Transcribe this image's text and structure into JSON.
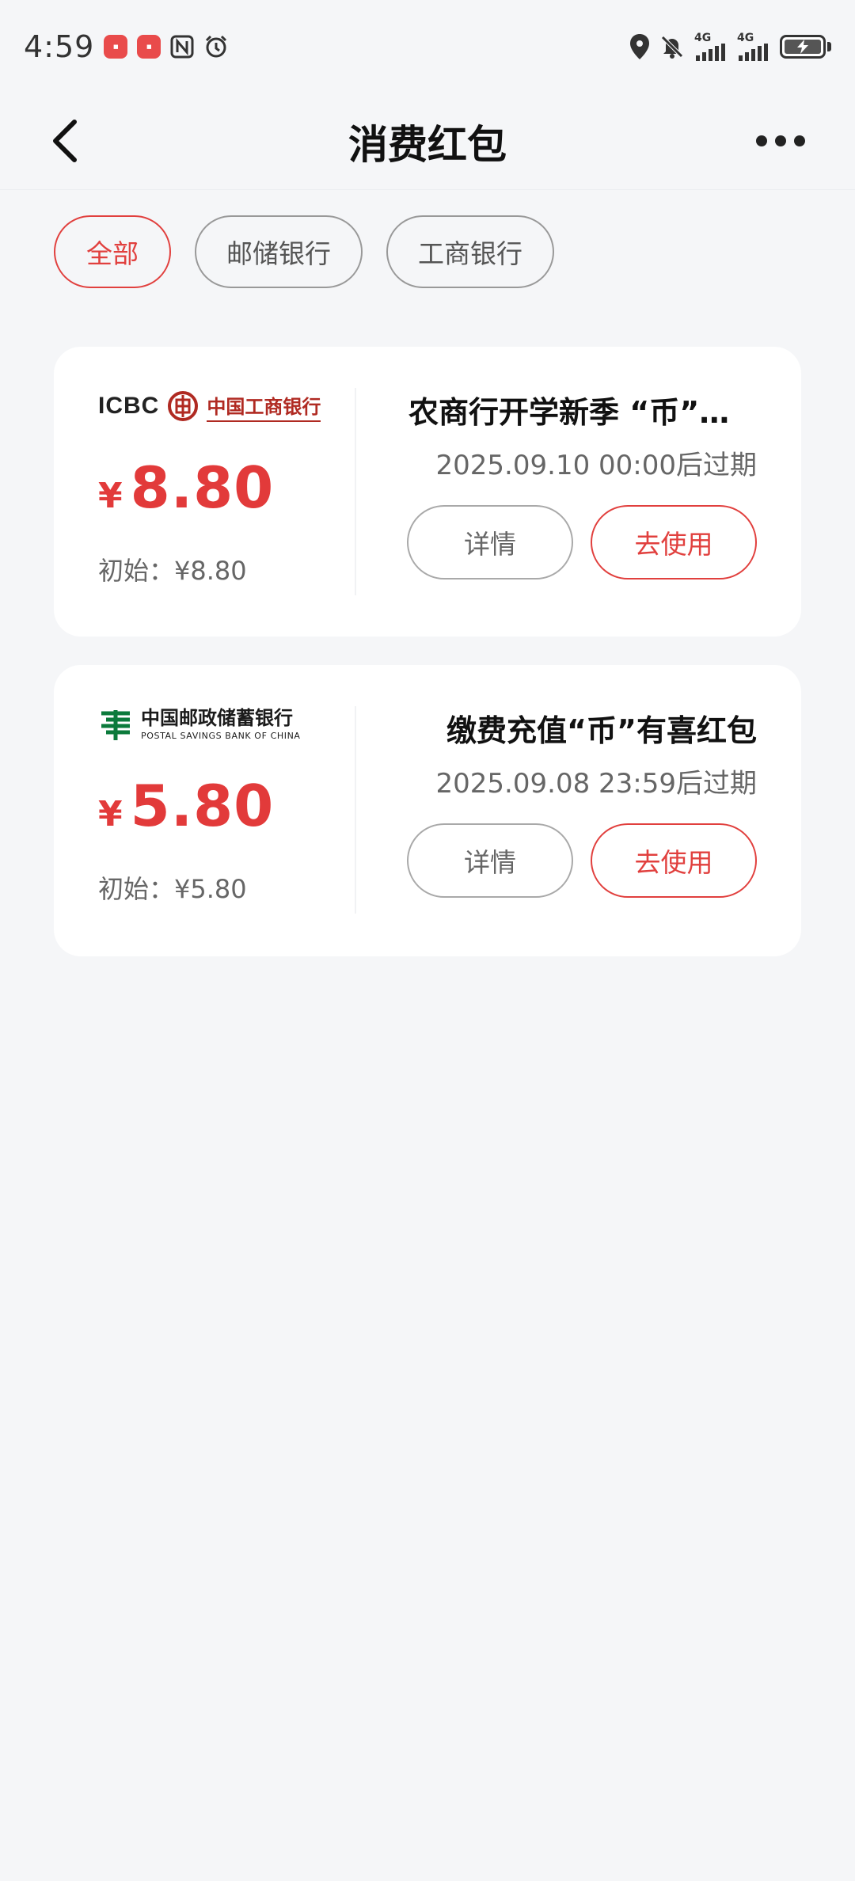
{
  "status_bar": {
    "time": "4:59",
    "network_1": "4G",
    "network_2": "4G"
  },
  "header": {
    "title": "消费红包"
  },
  "filters": [
    {
      "label": "全部",
      "active": true
    },
    {
      "label": "邮储银行",
      "active": false
    },
    {
      "label": "工商银行",
      "active": false
    }
  ],
  "coupons": [
    {
      "bank_logo_text": "ICBC",
      "bank_logo_cn": "中国工商银行",
      "currency": "¥",
      "amount": "8.80",
      "initial": "初始：¥8.80",
      "title": "农商行开学新季 “币”有…",
      "expiry": "2025.09.10 00:00后过期",
      "detail_label": "详情",
      "use_label": "去使用"
    },
    {
      "bank_logo_cn": "中国邮政储蓄银行",
      "bank_logo_en": "POSTAL SAVINGS BANK OF CHINA",
      "currency": "¥",
      "amount": "5.80",
      "initial": "初始：¥5.80",
      "title": "缴费充值“币”有喜红包",
      "expiry": "2025.09.08 23:59后过期",
      "detail_label": "详情",
      "use_label": "去使用"
    }
  ],
  "colors": {
    "accent": "#e1403e",
    "amount": "#e23a3a",
    "background": "#f5f6f8"
  }
}
